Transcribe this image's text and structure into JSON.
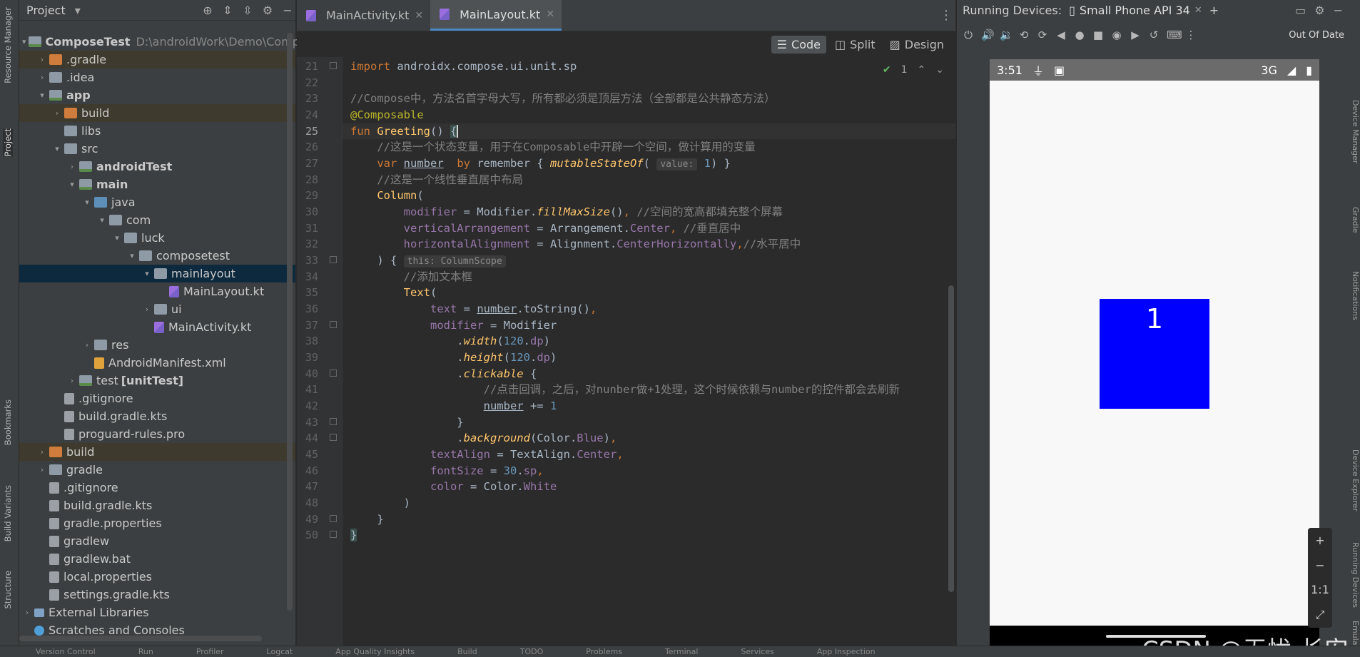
{
  "left_strip": [
    "Resource Manager",
    "Project",
    "Bookmarks",
    "Build Variants",
    "Structure"
  ],
  "right_strip": [
    "Device Manager",
    "Gradle",
    "Notifications",
    "Device Explorer",
    "Running Devices",
    "Emulator"
  ],
  "project_panel": {
    "title": "Project"
  },
  "tree": [
    {
      "indent": 0,
      "arrow": "▾",
      "icon": "mod",
      "label": "ComposeTest",
      "bold": true,
      "path": "D:\\androidWork\\Demo\\ComposeTe"
    },
    {
      "indent": 1,
      "arrow": "›",
      "icon": "folder-o",
      "label": ".gradle",
      "hl": true
    },
    {
      "indent": 1,
      "arrow": "›",
      "icon": "folder",
      "label": ".idea"
    },
    {
      "indent": 1,
      "arrow": "▾",
      "icon": "mod",
      "label": "app",
      "bold": true
    },
    {
      "indent": 2,
      "arrow": "›",
      "icon": "folder-o",
      "label": "build",
      "hl": true
    },
    {
      "indent": 2,
      "arrow": "",
      "icon": "folder",
      "label": "libs"
    },
    {
      "indent": 2,
      "arrow": "▾",
      "icon": "folder",
      "label": "src"
    },
    {
      "indent": 3,
      "arrow": "›",
      "icon": "mod",
      "label": "androidTest",
      "bold": true
    },
    {
      "indent": 3,
      "arrow": "▾",
      "icon": "mod",
      "label": "main",
      "bold": true
    },
    {
      "indent": 4,
      "arrow": "▾",
      "icon": "folder-b",
      "label": "java"
    },
    {
      "indent": 5,
      "arrow": "▾",
      "icon": "folder",
      "label": "com"
    },
    {
      "indent": 6,
      "arrow": "▾",
      "icon": "folder",
      "label": "luck"
    },
    {
      "indent": 7,
      "arrow": "▾",
      "icon": "folder",
      "label": "composetest"
    },
    {
      "indent": 8,
      "arrow": "▾",
      "icon": "folder",
      "label": "mainlayout",
      "sel": true
    },
    {
      "indent": 9,
      "arrow": "",
      "icon": "kt",
      "label": "MainLayout.kt"
    },
    {
      "indent": 8,
      "arrow": "›",
      "icon": "folder",
      "label": "ui"
    },
    {
      "indent": 8,
      "arrow": "",
      "icon": "kt",
      "label": "MainActivity.kt"
    },
    {
      "indent": 4,
      "arrow": "›",
      "icon": "folder",
      "label": "res"
    },
    {
      "indent": 4,
      "arrow": "",
      "icon": "xml",
      "label": "AndroidManifest.xml"
    },
    {
      "indent": 3,
      "arrow": "›",
      "icon": "mod",
      "label": "test",
      "suffix": "[unitTest]"
    },
    {
      "indent": 2,
      "arrow": "",
      "icon": "file",
      "label": ".gitignore"
    },
    {
      "indent": 2,
      "arrow": "",
      "icon": "file",
      "label": "build.gradle.kts"
    },
    {
      "indent": 2,
      "arrow": "",
      "icon": "file",
      "label": "proguard-rules.pro"
    },
    {
      "indent": 1,
      "arrow": "›",
      "icon": "folder-o",
      "label": "build",
      "hl": true
    },
    {
      "indent": 1,
      "arrow": "›",
      "icon": "folder",
      "label": "gradle"
    },
    {
      "indent": 1,
      "arrow": "",
      "icon": "file",
      "label": ".gitignore"
    },
    {
      "indent": 1,
      "arrow": "",
      "icon": "file",
      "label": "build.gradle.kts"
    },
    {
      "indent": 1,
      "arrow": "",
      "icon": "file",
      "label": "gradle.properties"
    },
    {
      "indent": 1,
      "arrow": "",
      "icon": "file",
      "label": "gradlew"
    },
    {
      "indent": 1,
      "arrow": "",
      "icon": "file",
      "label": "gradlew.bat"
    },
    {
      "indent": 1,
      "arrow": "",
      "icon": "file",
      "label": "local.properties"
    },
    {
      "indent": 1,
      "arrow": "",
      "icon": "file",
      "label": "settings.gradle.kts"
    },
    {
      "indent": 0,
      "arrow": "›",
      "icon": "lib",
      "label": "External Libraries"
    },
    {
      "indent": 0,
      "arrow": "",
      "icon": "scr",
      "label": "Scratches and Consoles"
    }
  ],
  "editor": {
    "tabs": [
      {
        "label": "MainActivity.kt",
        "active": false
      },
      {
        "label": "MainLayout.kt",
        "active": true
      }
    ],
    "modes": [
      {
        "label": "Code",
        "active": true
      },
      {
        "label": "Split",
        "active": false
      },
      {
        "label": "Design",
        "active": false
      }
    ],
    "inspection_count": "1",
    "current_line": 25,
    "lines": [
      {
        "n": 21,
        "fold": true,
        "html": "<span class=\"kw\">import</span> androidx.compose.ui.unit.sp"
      },
      {
        "n": 22,
        "html": ""
      },
      {
        "n": 23,
        "html": "<span class=\"cm\">//Compose中，方法名首字母大写，所有都必须是顶层方法（全部都是公共静态方法）</span>"
      },
      {
        "n": 24,
        "html": "<span class=\"an\">@Composable</span>"
      },
      {
        "n": 25,
        "html": "<span class=\"kw\">fun</span> <span class=\"fn\">Greeting</span>() <span class=\"bracket\">{</span><span class=\"caret\"></span>"
      },
      {
        "n": 26,
        "html": "    <span class=\"cm\">//这是一个状态变量，用于在Composable中开辟一个空间，做计算用的变量</span>"
      },
      {
        "n": 27,
        "html": "    <span class=\"kw\">var</span> <span class=\"ul\">number</span>  <span class=\"kw\">by</span> remember { <span class=\"it\">mutableStateOf</span>( <span class=\"hint\">value:</span> <span class=\"num\">1</span>) }"
      },
      {
        "n": 28,
        "html": "    <span class=\"cm\">//这是一个线性垂直居中布局</span>"
      },
      {
        "n": 29,
        "html": "    <span class=\"fn\">Column</span>("
      },
      {
        "n": 30,
        "html": "        <span class=\"pn\">modifier</span> = Modifier.<span class=\"it\">fillMaxSize</span>()<span class=\"kw\">,</span> <span class=\"cm\">//空间的宽高都填充整个屏幕</span>"
      },
      {
        "n": 31,
        "html": "        <span class=\"pn\">verticalArrangement</span> = Arrangement.<span class=\"pn\">Center</span><span class=\"kw\">,</span> <span class=\"cm\">//垂直居中</span>"
      },
      {
        "n": 32,
        "html": "        <span class=\"pn\">horizontalAlignment</span> = Alignment.<span class=\"pn\">CenterHorizontally</span><span class=\"kw\">,</span><span class=\"cm\">//水平居中</span>"
      },
      {
        "n": 33,
        "fold": true,
        "html": "    ) { <span class=\"hint\">this: ColumnScope</span>"
      },
      {
        "n": 34,
        "html": "        <span class=\"cm\">//添加文本框</span>"
      },
      {
        "n": 35,
        "html": "        <span class=\"fn\">Text</span>("
      },
      {
        "n": 36,
        "html": "            <span class=\"pn\">text</span> = <span class=\"ul\">number</span>.toString()<span class=\"kw\">,</span>"
      },
      {
        "n": 37,
        "fold": true,
        "html": "            <span class=\"pn\">modifier</span> = Modifier"
      },
      {
        "n": 38,
        "html": "                .<span class=\"it\">width</span>(<span class=\"num\">120</span>.<span class=\"pn\">dp</span>)"
      },
      {
        "n": 39,
        "html": "                .<span class=\"it\">height</span>(<span class=\"num\">120</span>.<span class=\"pn\">dp</span>)"
      },
      {
        "n": 40,
        "fold": true,
        "html": "                .<span class=\"it\">clickable</span> {"
      },
      {
        "n": 41,
        "html": "                    <span class=\"cm\">//点击回调，之后，对nunber做+1处理，这个时候依赖与number的控件都会去刷新</span>"
      },
      {
        "n": 42,
        "html": "                    <span class=\"ul\">number</span> += <span class=\"num\">1</span>"
      },
      {
        "n": 43,
        "fold": true,
        "html": "                }"
      },
      {
        "n": 44,
        "fold": true,
        "html": "                .<span class=\"it\">background</span>(Color.<span class=\"pn\">Blue</span>)<span class=\"kw\">,</span>"
      },
      {
        "n": 45,
        "html": "            <span class=\"pn\">textAlign</span> = TextAlign.<span class=\"pn\">Center</span><span class=\"kw\">,</span>"
      },
      {
        "n": 46,
        "html": "            <span class=\"pn\">fontSize</span> = <span class=\"num\">30</span>.<span class=\"pn\">sp</span><span class=\"kw\">,</span>"
      },
      {
        "n": 47,
        "html": "            <span class=\"pn\">color</span> = Color.<span class=\"pn\">White</span>"
      },
      {
        "n": 48,
        "html": "        )"
      },
      {
        "n": 49,
        "fold": true,
        "html": "    }"
      },
      {
        "n": 50,
        "fold": true,
        "html": "<span class=\"bracket\">}</span>"
      }
    ]
  },
  "devices": {
    "title": "Running Devices:",
    "device_tab": "Small Phone API 34",
    "out_of_date": "Out Of Date",
    "phone": {
      "time": "3:51",
      "network": "3G",
      "box_text": "1",
      "box_color": "#0000ff"
    },
    "zoom": [
      "+",
      "−",
      "1:1",
      "⤢"
    ]
  },
  "watermark": "CSDN @无忧-长安",
  "bottom_bar": [
    "Version Control",
    "Run",
    "Profiler",
    "Logcat",
    "App Quality Insights",
    "Build",
    "TODO",
    "Problems",
    "Terminal",
    "Services",
    "App Inspection"
  ]
}
